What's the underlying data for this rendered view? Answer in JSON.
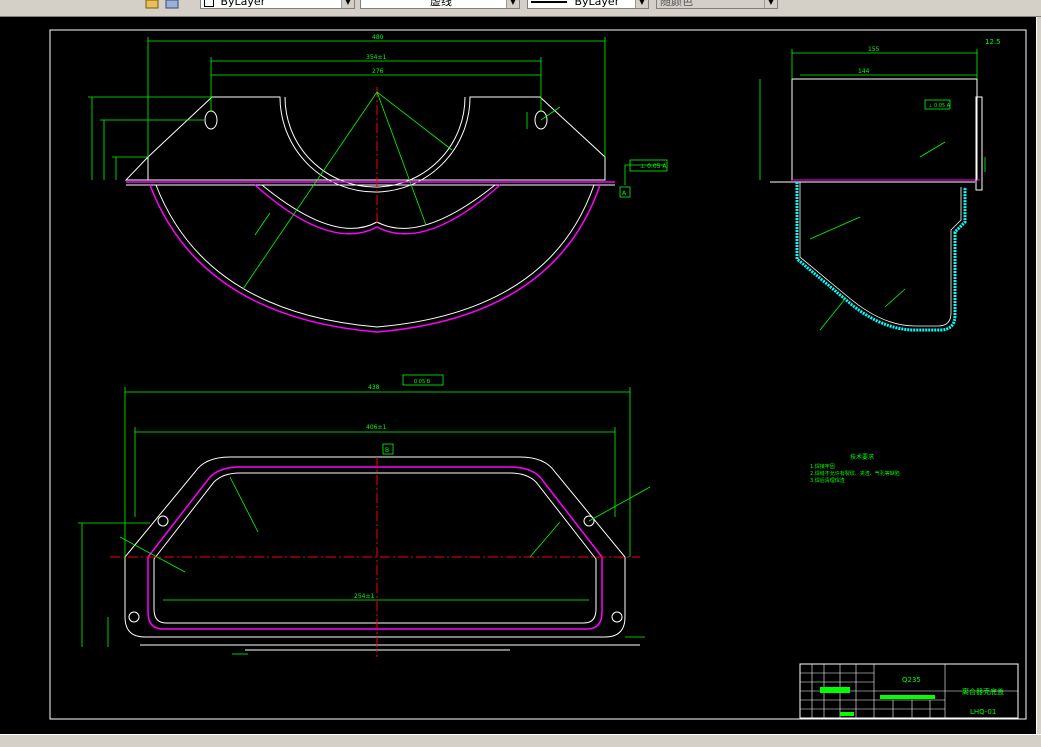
{
  "toolbar": {
    "layer_value": "ByLayer",
    "linetype_value": "虚线",
    "lineweight_value": "ByLayer",
    "plotstyle_value": "随颜色"
  },
  "colors": {
    "canvas_bg": "#000000",
    "dimension": "#00ff00",
    "outline": "#ffffff",
    "flange": "#ff00ff",
    "centerline": "#ff0000",
    "hatch": "#00ffff"
  },
  "drawing": {
    "notes_title": "技术要求",
    "note_line_1": "1.焊接牢固",
    "note_line_2": "2.焊缝不允许有裂纹、夹渣、气孔等缺陷",
    "note_line_3": "3.焊后清理焊渣",
    "title_block": {
      "material": "Q235",
      "part_name": "离合器壳底盖",
      "drawing_no": "LHQ-01"
    },
    "front_view": {
      "dim_overall_width": "480",
      "dim_bolt_span": "354±1",
      "dim_inner_span": "276",
      "roughness": "⊥ 0.05 A",
      "datum": "A"
    },
    "top_view": {
      "dim_overall_width": "438",
      "dim_inner_width": "406±1",
      "dim_bottom_width": "254±1",
      "datum": "B",
      "flatness": "0.05 B"
    },
    "side_view": {
      "dim_width": "155",
      "dim_inner": "144",
      "datum_tol": "⊥ 0.05 A",
      "roughness": "12.5"
    }
  }
}
